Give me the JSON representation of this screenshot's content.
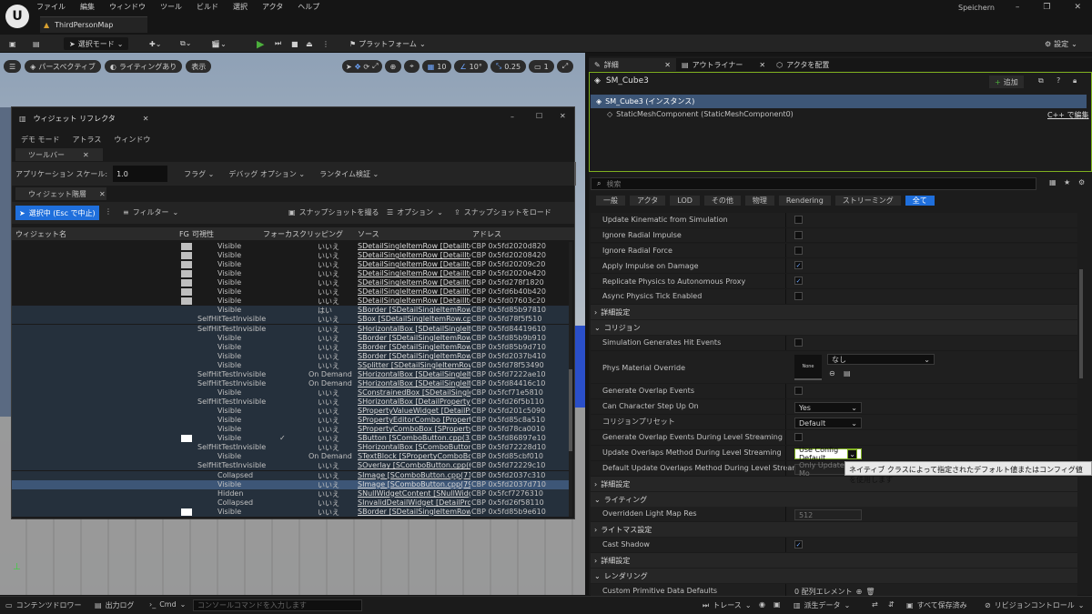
{
  "app": {
    "menu": [
      "ファイル",
      "編集",
      "ウィンドウ",
      "ツール",
      "ビルド",
      "選択",
      "アクタ",
      "ヘルプ"
    ],
    "map_tab": "ThirdPersonMap",
    "save_label": "Speichern"
  },
  "toolbar": {
    "select_mode": "選択モード",
    "platform": "プラットフォーム",
    "settings": "設定"
  },
  "viewport": {
    "perspective": "パースペクティブ",
    "lighting": "ライティングあり",
    "show": "表示",
    "grid": "10",
    "angle": "10°",
    "scale": "0.25",
    "camera": "1"
  },
  "reflector": {
    "title": "ウィジェット リフレクタ",
    "menu": [
      "デモ モード",
      "アトラス",
      "ウィンドウ"
    ],
    "toolbar_tab": "ツールバー",
    "app_scale_label": "アプリケーション スケール:",
    "app_scale_value": "1.0",
    "flags": "フラグ",
    "debug_options": "デバッグ オプション",
    "runtime_verify": "ランタイム検証",
    "hierarchy_tab": "ウィジェット階層",
    "select_btn": "選択中 (Esc で中止)",
    "filter": "フィルター",
    "take_snapshot": "スナップショットを撮る",
    "options": "オプション",
    "load_snapshot": "スナップショットをロード",
    "columns": [
      "ウィジェット名",
      "FG",
      "可視性",
      "フォーカス",
      "クリッピング",
      "ソース",
      "アドレス"
    ],
    "rows": [
      {
        "vis": "Visible",
        "focus": "",
        "clip": "いいえ",
        "src": "SDetailSingleItemRow [DetailItem",
        "addr": "CBP 0x5fd2020d820",
        "fg": "g"
      },
      {
        "vis": "Visible",
        "focus": "",
        "clip": "いいえ",
        "src": "SDetailSingleItemRow [DetailItem",
        "addr": "CBP 0x5fd20208420",
        "fg": "g"
      },
      {
        "vis": "Visible",
        "focus": "",
        "clip": "いいえ",
        "src": "SDetailSingleItemRow [DetailItem",
        "addr": "CBP 0x5fd20209c20",
        "fg": "g"
      },
      {
        "vis": "Visible",
        "focus": "",
        "clip": "いいえ",
        "src": "SDetailSingleItemRow [DetailItem",
        "addr": "CBP 0x5fd2020e420",
        "fg": "g"
      },
      {
        "vis": "Visible",
        "focus": "",
        "clip": "いいえ",
        "src": "SDetailSingleItemRow [DetailItem",
        "addr": "CBP 0x5fd278f1820",
        "fg": "g"
      },
      {
        "vis": "Visible",
        "focus": "",
        "clip": "いいえ",
        "src": "SDetailSingleItemRow [DetailItem",
        "addr": "CBP 0x5fd6b40b420",
        "fg": "g"
      },
      {
        "vis": "Visible",
        "focus": "",
        "clip": "いいえ",
        "src": "SDetailSingleItemRow [DetailItem",
        "addr": "CBP 0x5fd07603c20",
        "fg": "g"
      },
      {
        "vis": "Visible",
        "focus": "",
        "clip": "はい",
        "src": "SBorder [SDetailSingleItemRow.cp",
        "addr": "CBP 0x5fd85b97810",
        "fg": ""
      },
      {
        "vis": "SelfHitTestInvisible",
        "focus": "",
        "clip": "いいえ",
        "src": "SBox [SDetailSingleItemRow.cpp(2",
        "addr": "CBP 0x5fd78f5f510",
        "fg": ""
      },
      {
        "vis": "SelfHitTestInvisible",
        "focus": "",
        "clip": "いいえ",
        "src": "SHorizontalBox [SDetailSingleItem",
        "addr": "CBP 0x5fd84419610",
        "fg": ""
      },
      {
        "vis": "Visible",
        "focus": "",
        "clip": "いいえ",
        "src": "SBorder [SDetailSingleItemRow.cp",
        "addr": "CBP 0x5fd85b9b910",
        "fg": ""
      },
      {
        "vis": "Visible",
        "focus": "",
        "clip": "いいえ",
        "src": "SBorder [SDetailSingleItemRow.cp",
        "addr": "CBP 0x5fd85b9d710",
        "fg": ""
      },
      {
        "vis": "Visible",
        "focus": "",
        "clip": "いいえ",
        "src": "SBorder [SDetailSingleItemRow.cp",
        "addr": "CBP 0x5fd2037b410",
        "fg": ""
      },
      {
        "vis": "Visible",
        "focus": "",
        "clip": "いいえ",
        "src": "SSplitter [SDetailSingleItemRow.cp",
        "addr": "CBP 0x5fd78f53490",
        "fg": ""
      },
      {
        "vis": "SelfHitTestInvisible",
        "focus": "",
        "clip": "On Demand",
        "src": "SHorizontalBox [SDetailSingleItem",
        "addr": "CBP 0x5fd7222ae10",
        "fg": ""
      },
      {
        "vis": "SelfHitTestInvisible",
        "focus": "",
        "clip": "On Demand",
        "src": "SHorizontalBox [SDetailSingleItem",
        "addr": "CBP 0x5fd84416c10",
        "fg": ""
      },
      {
        "vis": "Visible",
        "focus": "",
        "clip": "いいえ",
        "src": "SConstrainedBox [SDetailSingleIte",
        "addr": "CBP 0x5fcf71e5810",
        "fg": ""
      },
      {
        "vis": "SelfHitTestInvisible",
        "focus": "",
        "clip": "いいえ",
        "src": "SHorizontalBox [DetailPropertyRo",
        "addr": "CBP 0x5fd26f5b110",
        "fg": ""
      },
      {
        "vis": "Visible",
        "focus": "",
        "clip": "いいえ",
        "src": "SPropertyValueWidget [DetailProp",
        "addr": "CBP 0x5fd201c5090",
        "fg": ""
      },
      {
        "vis": "Visible",
        "focus": "",
        "clip": "いいえ",
        "src": "SPropertyEditorCombo [PropertyE",
        "addr": "CBP 0x5fd85c8a510",
        "fg": ""
      },
      {
        "vis": "Visible",
        "focus": "",
        "clip": "いいえ",
        "src": "SPropertyComboBox [SPropertyEc",
        "addr": "CBP 0x5fd78ca0010",
        "fg": ""
      },
      {
        "vis": "Visible",
        "focus": "✓",
        "clip": "いいえ",
        "src": "SButton [SComboButton.cpp(33)]",
        "addr": "CBP 0x5fd86897e10",
        "fg": "w"
      },
      {
        "vis": "SelfHitTestInvisible",
        "focus": "",
        "clip": "いいえ",
        "src": "SHorizontalBox [SComboButton.cpp",
        "addr": "CBP 0x5fd72228d10",
        "fg": ""
      },
      {
        "vis": "Visible",
        "focus": "",
        "clip": "On Demand",
        "src": "STextBlock [SPropertyComboBox",
        "addr": "CBP 0x5fd85cbf010",
        "fg": ""
      },
      {
        "vis": "SelfHitTestInvisible",
        "focus": "",
        "clip": "いいえ",
        "src": "SOverlay [SComboButton.cpp(65)]",
        "addr": "CBP 0x5fd72229c10",
        "fg": ""
      },
      {
        "vis": "Collapsed",
        "focus": "",
        "clip": "いいえ",
        "src": "SImage [SComboButton.cpp(71)]",
        "addr": "CBP 0x5fd2037c310",
        "fg": ""
      },
      {
        "vis": "Visible",
        "focus": "",
        "clip": "いいえ",
        "src": "SImage [SComboButton.cpp(79)]",
        "addr": "CBP 0x5fd2037d710",
        "fg": "",
        "sel": true
      },
      {
        "vis": "Hidden",
        "focus": "",
        "clip": "いいえ",
        "src": "SNullWidgetContent [SNullWidget.c",
        "addr": "CBP 0x5fcf7276310",
        "fg": ""
      },
      {
        "vis": "Collapsed",
        "focus": "",
        "clip": "いいえ",
        "src": "SInvalidDetailWidget [DetailProp",
        "addr": "CBP 0x5fd26f58110",
        "fg": ""
      },
      {
        "vis": "Visible",
        "focus": "",
        "clip": "いいえ",
        "src": "SBorder [SDetailSingleItemRow.cp",
        "addr": "CBP 0x5fd85b9e610",
        "fg": "w"
      }
    ]
  },
  "details": {
    "tabs": [
      "詳細",
      "アウトライナー",
      "アクタを配置"
    ],
    "actor": "SM_Cube3",
    "add": "追加",
    "instance": "SM_Cube3 (インスタンス)",
    "component": "StaticMeshComponent (StaticMeshComponent0)",
    "cpp_edit": "C++ で編集",
    "search_placeholder": "検索",
    "filters": [
      "一般",
      "アクタ",
      "LOD",
      "その他",
      "物理",
      "Rendering",
      "ストリーミング",
      "全て"
    ],
    "physics_rows": [
      {
        "label": "Update Kinematic from Simulation",
        "checked": false
      },
      {
        "label": "Ignore Radial Impulse",
        "checked": false
      },
      {
        "label": "Ignore Radial Force",
        "checked": false
      },
      {
        "label": "Apply Impulse on Damage",
        "checked": true
      },
      {
        "label": "Replicate Physics to Autonomous Proxy",
        "checked": true
      },
      {
        "label": "Async Physics Tick Enabled",
        "checked": false
      }
    ],
    "advanced": "詳細設定",
    "collision": "コリジョン",
    "sim_hit": "Simulation Generates Hit Events",
    "phys_mat": "Phys Material Override",
    "phys_mat_value": "なし",
    "phys_mat_thumb": "None",
    "gen_overlap": "Generate Overlap Events",
    "step_up": "Can Character Step Up On",
    "step_up_value": "Yes",
    "preset": "コリジョンプリセット",
    "preset_value": "Default",
    "gen_overlap_stream": "Generate Overlap Events During Level Streaming",
    "update_overlap": "Update Overlaps Method During Level Streaming",
    "update_overlap_value": "Use Config Default",
    "default_update": "Default Update Overlaps Method During Level Streaming",
    "default_update_value": "Only Update Mo",
    "tooltip": "ネイティブ クラスによって指定されたデフォルト値またはコンフィグ値を使用します",
    "lighting": "ライティング",
    "override_lightmap": "Overridden Light Map Res",
    "override_lightmap_value": "512",
    "lightmass": "ライトマス設定",
    "cast_shadow": "Cast Shadow",
    "rendering": "レンダリング",
    "custom_prim": "Custom Primitive Data Defaults",
    "custom_prim_value": "0 配列エレメント"
  },
  "status": {
    "content_drawer": "コンテンツドロワー",
    "output_log": "出力ログ",
    "cmd": "Cmd",
    "console_placeholder": "コンソールコマンドを入力します",
    "trace": "トレース",
    "derived": "派生データ",
    "save_all": "すべて保存済み",
    "revision": "リビジョンコントロール"
  }
}
